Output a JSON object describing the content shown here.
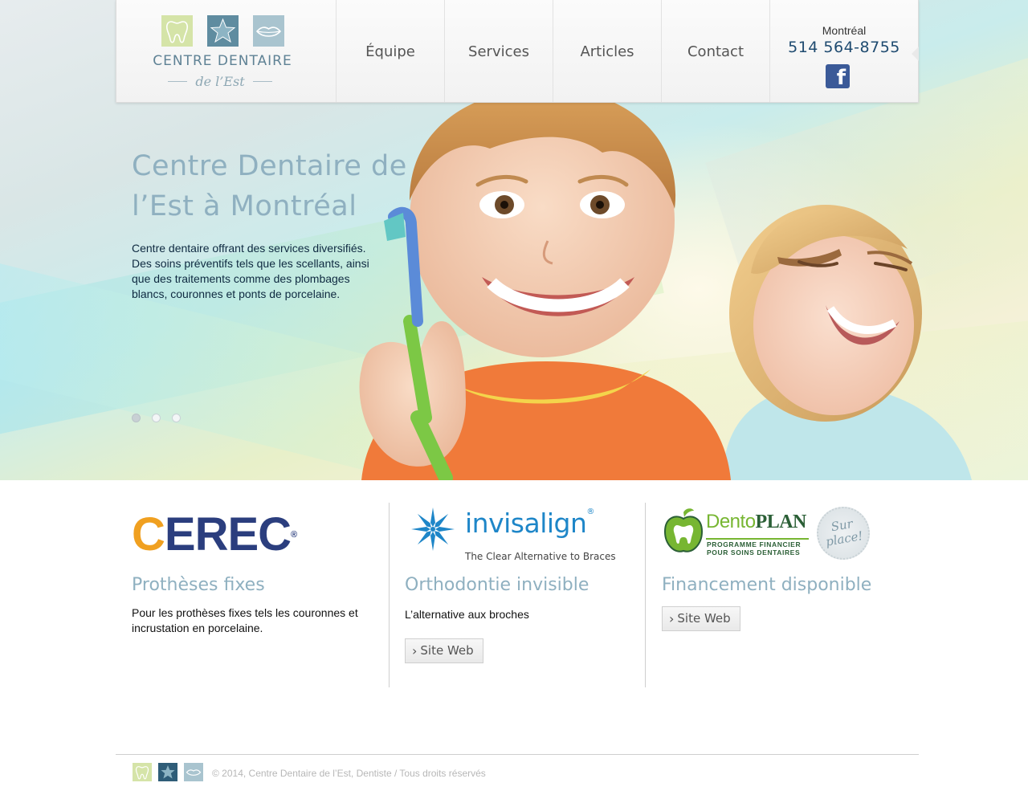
{
  "header": {
    "logo": {
      "name": "CENTRE DENTAIRE",
      "sub": "de l’Est"
    },
    "nav": [
      {
        "label": "Équipe"
      },
      {
        "label": "Services"
      },
      {
        "label": "Articles"
      },
      {
        "label": "Contact"
      }
    ],
    "contact": {
      "city": "Montréal",
      "phone": "514 564-8755",
      "social_icon": "facebook-icon"
    }
  },
  "hero": {
    "title": "Centre Dentaire de l’Est à Montréal",
    "text": "Centre dentaire offrant des services diversifiés. Des soins préventifs tels que les scellants, ainsi que des traitements comme des plombages blancs, couronnes et ponts de porcelaine.",
    "slider_dots": 3,
    "active_dot": 1
  },
  "features": [
    {
      "logo": {
        "c": "C",
        "rest": "EREC",
        "reg": "®"
      },
      "title": "Prothèses fixes",
      "text": "Pour les prothèses fixes tels les couronnes et incrustation en porcelaine."
    },
    {
      "logo": {
        "name": "invisalign",
        "reg": "®",
        "tagline": "The Clear Alternative to Braces"
      },
      "title": "Orthodontie invisible",
      "text": "L’alternative aux broches",
      "button": "Site Web"
    },
    {
      "logo": {
        "dento": "Dento",
        "plan": "PLAN",
        "line1": "PROGRAMME FINANCIER",
        "line2": "POUR SOINS DENTAIRES",
        "seal1": "Sur",
        "seal2": "place!"
      },
      "title": "Financement disponible",
      "button": "Site Web"
    }
  ],
  "footer": {
    "copyright": "© 2014, Centre Dentaire de l’Est, Dentiste / Tous droits réservés"
  },
  "colors": {
    "accent_title": "#8fb0c0",
    "phone": "#1f4b70",
    "cerec_orange": "#f0a020",
    "cerec_blue": "#2b3e7e",
    "invisalign_blue": "#1e86c8",
    "dento_green": "#77b632"
  }
}
